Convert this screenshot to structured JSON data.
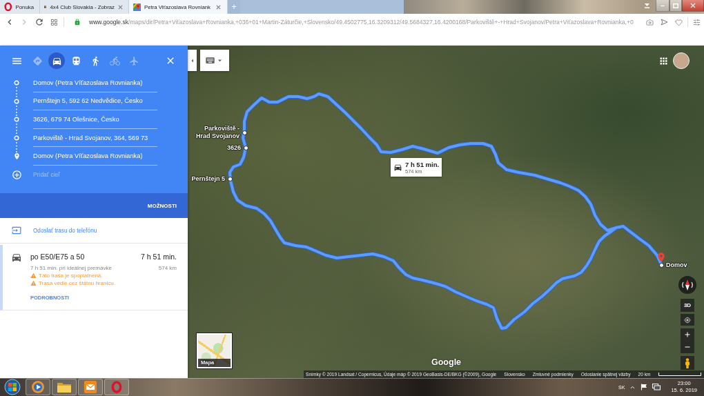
{
  "browser": {
    "tabs": [
      {
        "kind": "opera",
        "title": "Ponuka",
        "selected": false,
        "closable": false
      },
      {
        "kind": "club",
        "title": "4x4 Club Slovakia - Zobraz",
        "selected": false,
        "closable": true
      },
      {
        "kind": "maps",
        "title": "Petra Viťazoslava Rovniank",
        "selected": true,
        "closable": true
      }
    ],
    "new_tab": "+",
    "address": {
      "url": "**www.google.sk**/maps/dir/Petra+Viťazoslava+Rovnianka,+036+01+Martin-Záturčie,+Slovensko/49.4502775,16.3209312/49.5684327,16.4200168/Parkoviště+-+Hrad+Svojanov/Petra+Viťazoslava+Rovnianka,+0",
      "secure": true
    }
  },
  "directions": {
    "modes": [
      {
        "kind": "best",
        "selected": false,
        "disabled": true
      },
      {
        "kind": "car",
        "selected": true,
        "disabled": false
      },
      {
        "kind": "transit",
        "selected": false,
        "disabled": false
      },
      {
        "kind": "walk",
        "selected": false,
        "disabled": false
      },
      {
        "kind": "bike",
        "selected": false,
        "disabled": true
      },
      {
        "kind": "flight",
        "selected": false,
        "disabled": true
      }
    ],
    "stops": [
      {
        "kind": "waypoint",
        "value": "Domov (Petra Víťazoslava Rovnianka)"
      },
      {
        "kind": "waypoint",
        "value": "Pernštejn 5, 592 62 Nedvědice, Česko"
      },
      {
        "kind": "waypoint",
        "value": "3626, 679 74 Olešnice, Česko"
      },
      {
        "kind": "waypoint",
        "value": "Parkoviště - Hrad Svojanov, 364, 569 73"
      },
      {
        "kind": "destination",
        "value": "Domov (Petra Víťazoslava Rovnianka)"
      }
    ],
    "add_stop": {
      "placeholder": "Pridať cieľ"
    },
    "options": "MOŽNOSTI",
    "send_to_phone": "Odoslať trasu do telefónu",
    "routes": [
      {
        "selected": true,
        "title": "po E50/E75 a 50",
        "duration": "7 h 51 min.",
        "note": "7 h 51 min. pri ideálnej premávke",
        "distance": "574 km",
        "warnings": [
          "Táto trasa je spoplatnená.",
          "Trasa vedie cez štátnu hranicu."
        ],
        "details": "PODROBNOSTI"
      }
    ]
  },
  "map": {
    "route_label": {
      "duration": "7 h 51 min.",
      "distance": "574 km"
    },
    "waypoints": [
      {
        "kind": "stop",
        "label": "Parkoviště - Hrad Svojanov"
      },
      {
        "kind": "stop",
        "label": "3626"
      },
      {
        "kind": "stop",
        "label": "Pernštejn 5"
      },
      {
        "kind": "home",
        "label": "Domov"
      }
    ],
    "tilt_button": "3D",
    "minimap_label": "Mapa",
    "logo": "Google",
    "footer": [
      "Snímky © 2019 Landsat / Copernicus, Údaje máp © 2019 GeoBasis-DE/BKG (©2009), Google",
      "Slovensko",
      "Zmluvné podmienky",
      "Odoslanie spätnej väzby"
    ],
    "scale": "20 km"
  },
  "taskbar": {
    "apps": [
      {
        "kind": "media"
      },
      {
        "kind": "folder"
      },
      {
        "kind": "mail"
      },
      {
        "kind": "opera"
      }
    ],
    "language": "SK",
    "time": "23:00",
    "date": "15. 6. 2019"
  }
}
